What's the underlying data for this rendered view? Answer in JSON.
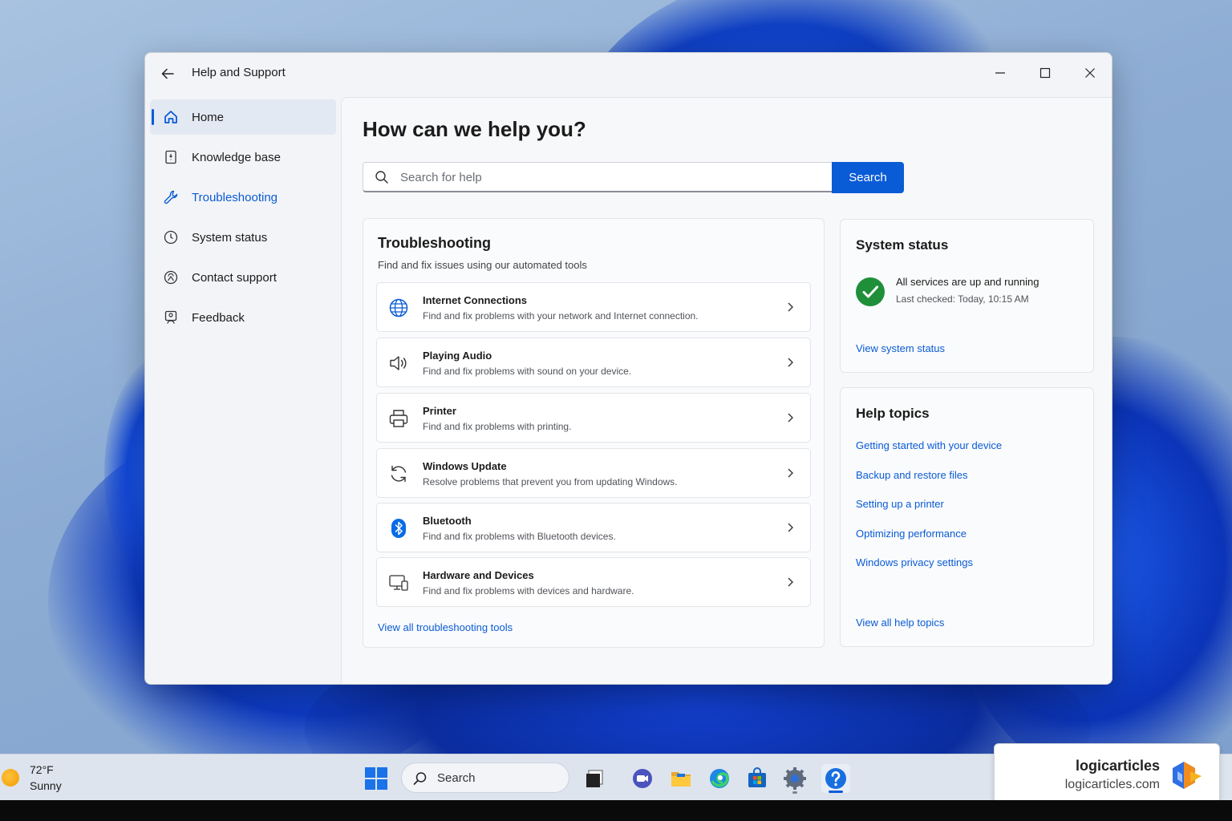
{
  "window": {
    "title": "Help and Support"
  },
  "sidebar": {
    "items": [
      {
        "label": "Home",
        "icon": "home-icon"
      },
      {
        "label": "Knowledge base",
        "icon": "book-icon"
      },
      {
        "label": "Troubleshooting",
        "icon": "wrench-icon"
      },
      {
        "label": "System status",
        "icon": "clock-icon"
      },
      {
        "label": "Contact support",
        "icon": "person-circle-icon"
      },
      {
        "label": "Feedback",
        "icon": "feedback-icon"
      }
    ],
    "active_index": 0
  },
  "main": {
    "title": "How can we help you?",
    "search": {
      "placeholder": "Search for help",
      "value": "",
      "button_label": "Search"
    },
    "troubleshooting": {
      "title": "Troubleshooting",
      "subtitle": "Find and fix issues using our automated tools",
      "items": [
        {
          "name": "Internet Connections",
          "description": "Find and fix problems with your network and Internet connection.",
          "icon": "globe-icon"
        },
        {
          "name": "Playing Audio",
          "description": "Find and fix problems with sound on your device.",
          "icon": "speaker-icon"
        },
        {
          "name": "Printer",
          "description": "Find and fix problems with printing.",
          "icon": "printer-icon"
        },
        {
          "name": "Windows Update",
          "description": "Resolve problems that prevent you from updating Windows.",
          "icon": "sync-icon"
        },
        {
          "name": "Bluetooth",
          "description": "Find and fix problems with Bluetooth devices.",
          "icon": "bluetooth-icon"
        },
        {
          "name": "Hardware and Devices",
          "description": "Find and fix problems with devices and hardware.",
          "icon": "devices-icon"
        }
      ],
      "view_all": "View all troubleshooting tools"
    },
    "system_status": {
      "title": "System status",
      "status_text": "All services are up and running",
      "last_checked": "Last checked: Today, 10:15 AM",
      "link": "View system status"
    },
    "help_topics": {
      "title": "Help topics",
      "links": [
        "Getting started with your device",
        "Backup and restore files",
        "Setting up a printer",
        "Optimizing performance",
        "Windows privacy settings"
      ],
      "view_all": "View all help topics"
    }
  },
  "taskbar": {
    "weather": {
      "temp": "72°F",
      "condition": "Sunny"
    },
    "search_label": "Search",
    "apps": [
      "task-view-icon",
      "chat-icon",
      "file-explorer-icon",
      "edge-icon",
      "store-icon",
      "settings-icon",
      "help-icon"
    ]
  },
  "brand": {
    "name": "logicarticles",
    "url": "logicarticles.com"
  },
  "colors": {
    "accent": "#0a5bd6",
    "success": "#1f8f3a"
  }
}
